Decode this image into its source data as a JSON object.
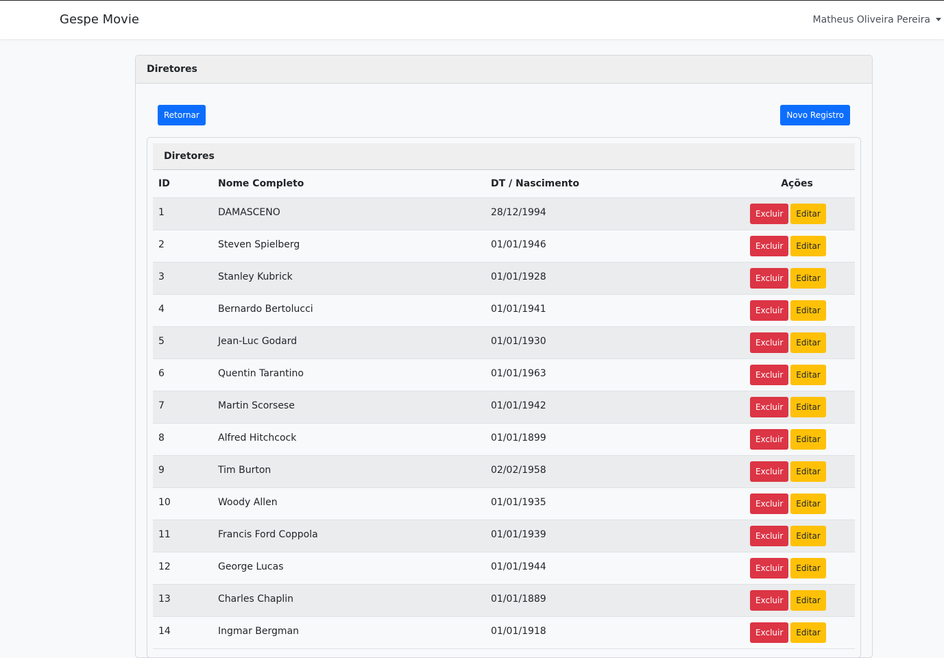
{
  "navbar": {
    "brand": "Gespe Movie",
    "user": "Matheus Oliveira Pereira"
  },
  "card": {
    "title": "Diretores",
    "back_label": "Retornar",
    "new_label": "Novo Registro"
  },
  "table": {
    "title": "Diretores",
    "headers": {
      "id": "ID",
      "nome": "Nome Completo",
      "dt": "DT / Nascimento",
      "acoes": "Ações"
    },
    "delete_label": "Excluir",
    "edit_label": "Editar",
    "rows": [
      {
        "id": "1",
        "nome": "DAMASCENO",
        "dt": "28/12/1994"
      },
      {
        "id": "2",
        "nome": "Steven Spielberg",
        "dt": "01/01/1946"
      },
      {
        "id": "3",
        "nome": "Stanley Kubrick",
        "dt": "01/01/1928"
      },
      {
        "id": "4",
        "nome": "Bernardo Bertolucci",
        "dt": "01/01/1941"
      },
      {
        "id": "5",
        "nome": "Jean-Luc Godard",
        "dt": "01/01/1930"
      },
      {
        "id": "6",
        "nome": "Quentin Tarantino",
        "dt": "01/01/1963"
      },
      {
        "id": "7",
        "nome": "Martin Scorsese",
        "dt": "01/01/1942"
      },
      {
        "id": "8",
        "nome": "Alfred Hitchcock",
        "dt": "01/01/1899"
      },
      {
        "id": "9",
        "nome": "Tim Burton",
        "dt": "02/02/1958"
      },
      {
        "id": "10",
        "nome": "Woody Allen",
        "dt": "01/01/1935"
      },
      {
        "id": "11",
        "nome": "Francis Ford Coppola",
        "dt": "01/01/1939"
      },
      {
        "id": "12",
        "nome": "George Lucas",
        "dt": "01/01/1944"
      },
      {
        "id": "13",
        "nome": "Charles Chaplin",
        "dt": "01/01/1889"
      },
      {
        "id": "14",
        "nome": "Ingmar Bergman",
        "dt": "01/01/1918"
      }
    ]
  }
}
